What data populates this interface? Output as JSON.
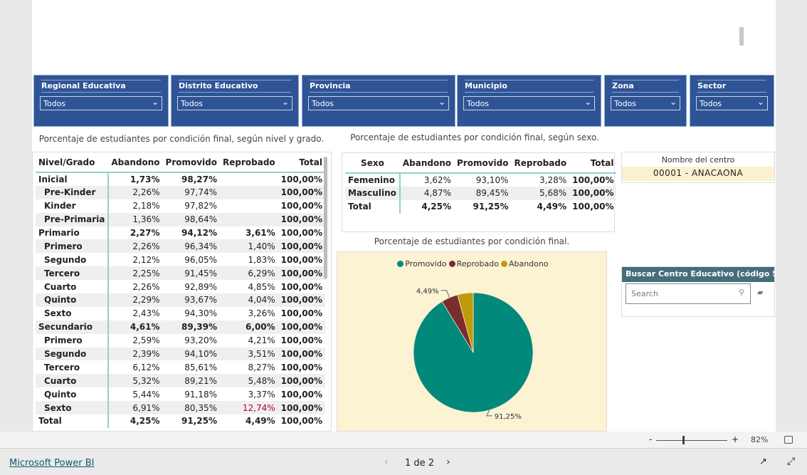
{
  "filters": [
    {
      "label": "Regional Educativa",
      "value": "Todos"
    },
    {
      "label": "Distrito Educativo",
      "value": "Todos"
    },
    {
      "label": "Provincia",
      "value": "Todos"
    },
    {
      "label": "Municipio",
      "value": "Todos"
    },
    {
      "label": "Zona",
      "value": "Todos"
    },
    {
      "label": "Sector",
      "value": "Todos"
    }
  ],
  "main_table": {
    "caption": "Porcentaje de estudiantes por condición final, según nivel y grado.",
    "headers": [
      "Nivel/Grado",
      "Abandono",
      "Promovido",
      "Reprobado",
      "Total"
    ],
    "rows": [
      [
        "Inicial",
        "1,73%",
        "98,27%",
        "",
        "100,00%"
      ],
      [
        "Pre-Kinder",
        "2,26%",
        "97,74%",
        "",
        "100,00%"
      ],
      [
        "Kinder",
        "2,18%",
        "97,82%",
        "",
        "100,00%"
      ],
      [
        "Pre-Primaria",
        "1,36%",
        "98,64%",
        "",
        "100,00%"
      ],
      [
        "Primario",
        "2,27%",
        "94,12%",
        "3,61%",
        "100,00%"
      ],
      [
        "Primero",
        "2,26%",
        "96,34%",
        "1,40%",
        "100,00%"
      ],
      [
        "Segundo",
        "2,12%",
        "96,05%",
        "1,83%",
        "100,00%"
      ],
      [
        "Tercero",
        "2,25%",
        "91,45%",
        "6,29%",
        "100,00%"
      ],
      [
        "Cuarto",
        "2,26%",
        "92,89%",
        "4,85%",
        "100,00%"
      ],
      [
        "Quinto",
        "2,29%",
        "93,67%",
        "4,04%",
        "100,00%"
      ],
      [
        "Sexto",
        "2,43%",
        "94,30%",
        "3,26%",
        "100,00%"
      ],
      [
        "Secundario",
        "4,61%",
        "89,39%",
        "6,00%",
        "100,00%"
      ],
      [
        "Primero",
        "2,59%",
        "93,20%",
        "4,21%",
        "100,00%"
      ],
      [
        "Segundo",
        "2,39%",
        "94,10%",
        "3,51%",
        "100,00%"
      ],
      [
        "Tercero",
        "6,12%",
        "85,61%",
        "8,27%",
        "100,00%"
      ],
      [
        "Cuarto",
        "5,32%",
        "89,21%",
        "5,48%",
        "100,00%"
      ],
      [
        "Quinto",
        "5,44%",
        "91,18%",
        "3,37%",
        "100,00%"
      ],
      [
        "Sexto",
        "6,91%",
        "80,35%",
        "12,74%",
        "100,00%"
      ],
      [
        "Total",
        "4,25%",
        "91,25%",
        "4,49%",
        "100,00%"
      ]
    ],
    "group_rows": [
      0,
      4,
      11,
      18
    ],
    "highlight": {
      "row": 17,
      "col": 3,
      "color": "#b4002a"
    }
  },
  "sex_table": {
    "caption": "Porcentaje de estudiantes por condición final, según sexo.",
    "headers": [
      "Sexo",
      "Abandono",
      "Promovido",
      "Reprobado",
      "Total"
    ],
    "rows": [
      [
        "Femenino",
        "3,62%",
        "93,10%",
        "3,28%",
        "100,00%"
      ],
      [
        "Masculino",
        "4,87%",
        "89,45%",
        "5,68%",
        "100,00%"
      ],
      [
        "Total",
        "4,25%",
        "91,25%",
        "4,49%",
        "100,00%"
      ]
    ]
  },
  "card": {
    "label": "Nombre del centro",
    "value": "00001 - ANACAONA"
  },
  "search": {
    "title": "Buscar Centro Educativo (código 5 ...",
    "placeholder": "Search"
  },
  "chart_data": {
    "type": "pie",
    "title": "Porcentaje de estudiantes por condición final.",
    "legend": "top",
    "categories": [
      "Promovido",
      "Reprobado",
      "Abandono"
    ],
    "values": [
      91.25,
      4.49,
      4.25
    ],
    "colors": [
      "#01897b",
      "#7b2d2d",
      "#bf9b0c"
    ],
    "data_labels": [
      "91,25%",
      "4,49%",
      ""
    ]
  },
  "toolbar": {
    "zoom": "82%",
    "minus": "-",
    "plus": "+"
  },
  "footer": {
    "brand": "Microsoft Power BI",
    "page": "1 de 2"
  }
}
